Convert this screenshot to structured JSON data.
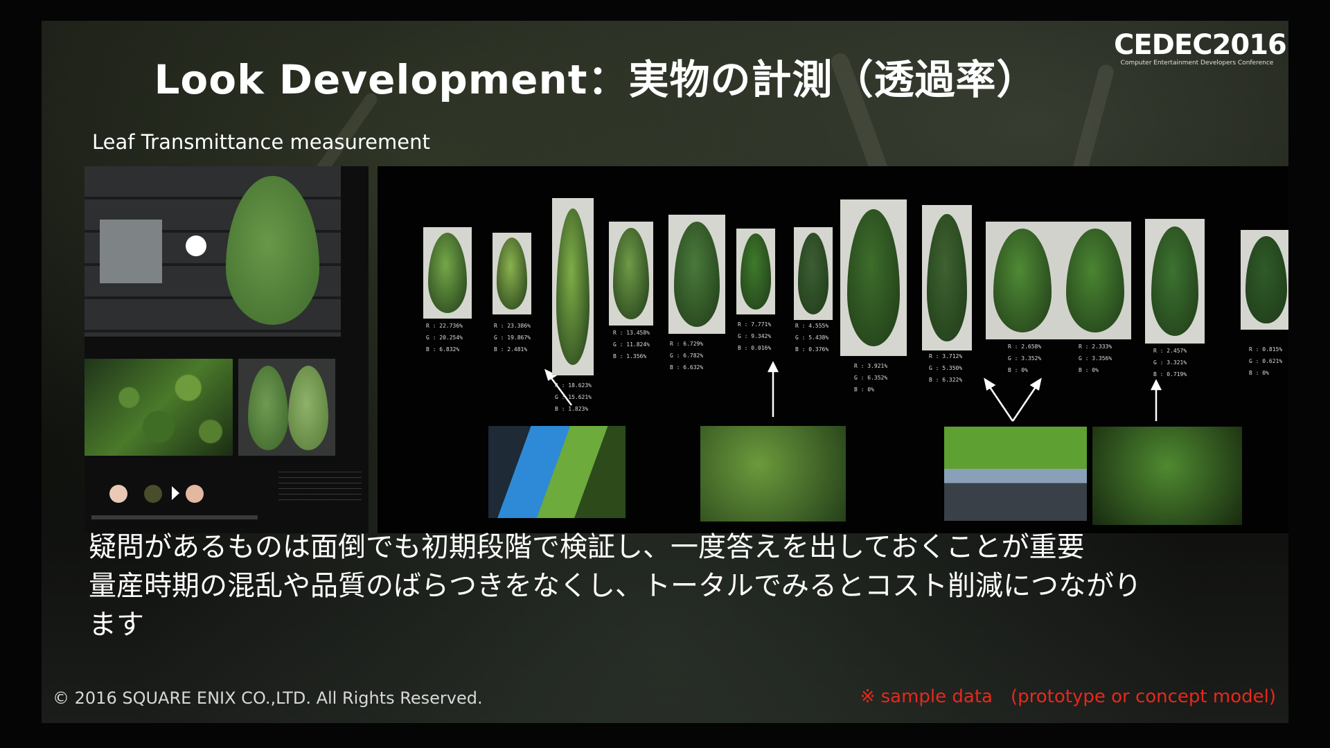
{
  "slide": {
    "title": "Look Development：実物の計測（透過率）",
    "logo": {
      "main": "CEDEC2016",
      "sub": "Computer Entertainment Developers Conference"
    },
    "subtitle": "Leaf Transmittance measurement",
    "samples": [
      {
        "label": "R : 22.736%\nG : 20.254%\nB : 6.832%",
        "leaf_color": "#74a748"
      },
      {
        "label": "R : 23.386%\nG : 19.867%\nB : 2.481%",
        "leaf_color": "#8bb24e"
      },
      {
        "label": "R : 18.623%\nG : 15.621%\nB : 1.823%",
        "leaf_color": "#7fae48"
      },
      {
        "label": "R : 13.458%\nG : 11.824%\nB : 1.356%",
        "leaf_color": "#6f9b47"
      },
      {
        "label": "R : 6.729%\nG : 6.782%\nB : 6.632%",
        "leaf_color": "#4a7a3a"
      },
      {
        "label": "R : 7.771%\nG : 9.342%\nB : 0.016%",
        "leaf_color": "#3f7a2c"
      },
      {
        "label": "R : 4.555%\nG : 5.438%\nB : 0.376%",
        "leaf_color": "#3c5e34"
      },
      {
        "label": "R : 3.921%\nG : 6.352%\nB : 0%",
        "leaf_color": "#3d6d2b"
      },
      {
        "label": "R : 3.712%\nG : 5.350%\nB : 6.322%",
        "leaf_color": "#3e6230"
      },
      {
        "label": "R : 2.658%\nG : 3.352%\nB : 0%",
        "leaf_color": "#4f8a35"
      },
      {
        "label": "R : 2.333%\nG : 3.356%\nB : 0%",
        "leaf_color": "#4a8532"
      },
      {
        "label": "R : 2.457%\nG : 3.321%\nB : 0.719%",
        "leaf_color": "#3c7230"
      },
      {
        "label": "R : 0.815%\nG : 0.621%\nB : 0%",
        "leaf_color": "#2f5a28"
      }
    ],
    "swatch_colors": [
      "#e9c9b6",
      "#4a4d2a",
      "#e4b7a0"
    ],
    "body_lines": [
      "疑問があるものは面倒でも初期段階で検証し、一度答えを出しておくことが重要",
      "量産時期の混乱や品質のばらつきをなくし、トータルでみるとコスト削減につながり",
      "ます"
    ],
    "copyright": "© 2016 SQUARE ENIX CO.,LTD. All Rights Reserved.",
    "note": "※ sample data　(prototype or concept model)"
  }
}
